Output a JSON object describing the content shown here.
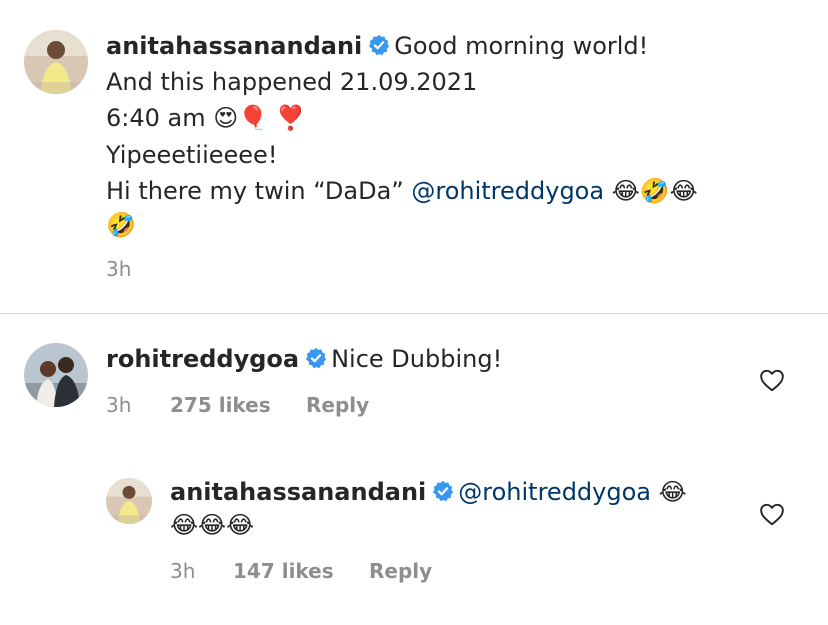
{
  "comment1": {
    "username": "anitahassanandani",
    "lines": [
      "Good morning world!",
      "And this happened 21.09.2021",
      "6:40 am 😍🎈 ❣️",
      "Yipeeetiieeee!",
      "Hi there my twin “DaDa” ",
      "@rohitreddygoa",
      " 😂🤣😂",
      "🤣"
    ],
    "time": "3h"
  },
  "comment2": {
    "username": "rohitreddygoa",
    "text": "Nice Dubbing!",
    "time": "3h",
    "likes": "275 likes",
    "reply": "Reply"
  },
  "comment3": {
    "username": "anitahassanandani",
    "mention": "@rohitreddygoa",
    "emoji_line1": " 😂",
    "emoji_line2": "😂😂😂",
    "time": "3h",
    "likes": "147 likes",
    "reply": "Reply"
  },
  "icons": {
    "verified": "verified-badge-icon",
    "heart": "heart-outline-icon"
  },
  "colors": {
    "text": "#262626",
    "secondary": "#8e8e8e",
    "mention": "#00376b",
    "verified": "#3897f0",
    "divider": "#dbdbdb"
  }
}
